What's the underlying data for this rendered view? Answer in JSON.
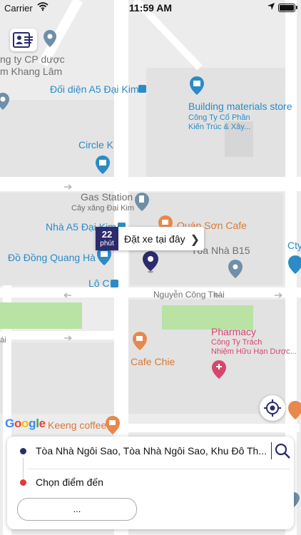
{
  "status_bar": {
    "carrier": "Carrier",
    "time": "11:59 AM"
  },
  "map": {
    "labels": {
      "company_cp": "ng ty CP dược",
      "company_cp_2": "m Khang Lâm",
      "doi_dien": "Đối diện A5 Đại Kim",
      "building_store": "Building materials store",
      "building_store_sub1": "Công Ty Cổ Phần",
      "building_store_sub2": "Kiến Trúc & Xây...",
      "circle_k": "Circle K",
      "gas_station": "Gas Station",
      "gas_station_sub": "Cây xăng Đại Kim",
      "quan_son_cafe": "Quán Sơn Cafe",
      "nha_a5": "Nhà A5 Đại Kim",
      "do_dong": "Đồ Đồng Quang Hà",
      "toa_nha_b15": "Tòa Nhà B15",
      "cty": "Cty",
      "lo_c": "Lô C",
      "street": "Nguyễn Công Thái",
      "ai": "ái",
      "pharmacy": "Pharmacy",
      "pharmacy_sub1": "Công Ty Trách",
      "pharmacy_sub2": "Nhiệm Hữu Hạn Dược...",
      "cafe_chie": "Cafe Chie",
      "keeng_coffee": "Keeng coffee",
      "google_logo": "Google"
    },
    "pickup_bubble": {
      "eta_number": "22",
      "eta_unit": "phút",
      "text": "Đặt xe tại đây"
    }
  },
  "panel": {
    "pickup_value": "Tòa Nhà Ngôi Sao, Tòa Nhà Ngôi Sao, Khu Đô Th...",
    "destination_placeholder": "Chọn điểm đến",
    "more_label": "..."
  },
  "colors": {
    "accent": "#2c2b6e",
    "destination_dot": "#e53935",
    "pickup_dot": "#2c2b6e",
    "poi_blue": "#2a8bc7",
    "poi_pink": "#d8466b",
    "poi_orange": "#e8884a"
  },
  "icons": {
    "card": "id-card-icon",
    "gps": "crosshair-icon",
    "search": "search-icon"
  }
}
